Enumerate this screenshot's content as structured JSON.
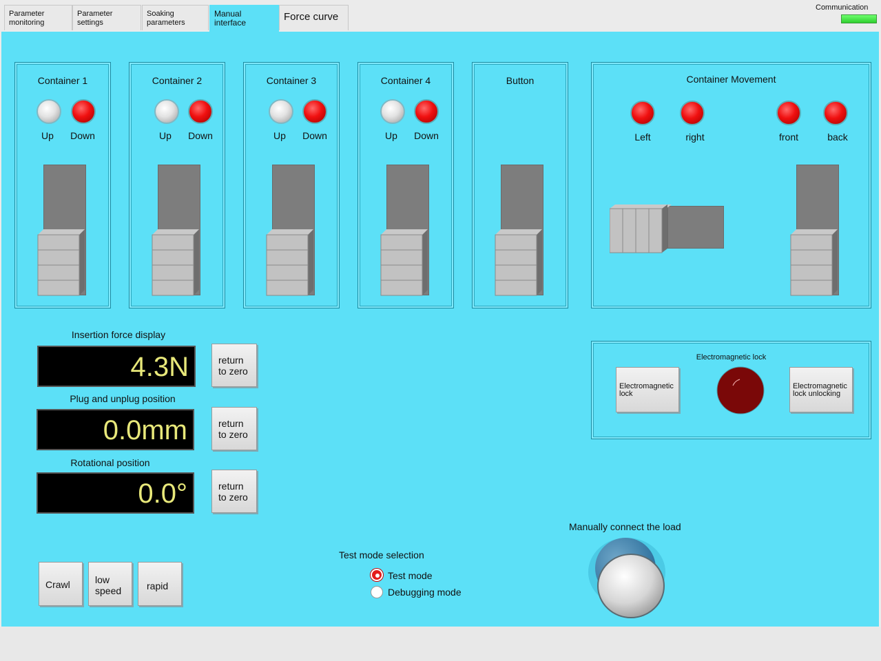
{
  "tabs": [
    {
      "label_1": "Parameter",
      "label_2": "monitoring"
    },
    {
      "label_1": "Parameter",
      "label_2": "settings"
    },
    {
      "label_1": "Soaking",
      "label_2": "parameters"
    },
    {
      "label_1": "Manual",
      "label_2": "interface"
    },
    {
      "label_1": "Force curve",
      "label_2": ""
    }
  ],
  "active_tab": "Manual interface",
  "communication": {
    "label": "Communication",
    "status_color": "#3fdc3f"
  },
  "containers": [
    {
      "title": "Container 1",
      "up": "Up",
      "down": "Down"
    },
    {
      "title": "Container 2",
      "up": "Up",
      "down": "Down"
    },
    {
      "title": "Container 3",
      "up": "Up",
      "down": "Down"
    },
    {
      "title": "Container 4",
      "up": "Up",
      "down": "Down"
    }
  ],
  "button_panel": {
    "title": "Button"
  },
  "movement": {
    "title": "Container Movement",
    "left": "Left",
    "right": "right",
    "front": "front",
    "back": "back"
  },
  "displays": {
    "force": {
      "label": "Insertion force display",
      "value": "4.3N",
      "reset": [
        "return",
        "to zero"
      ]
    },
    "position": {
      "label": "Plug and unplug position",
      "value": "0.0mm",
      "reset": [
        "return",
        "to zero"
      ]
    },
    "rotation": {
      "label": "Rotational position",
      "value": "0.0°",
      "reset": [
        "return",
        "to zero"
      ]
    }
  },
  "speed": {
    "crawl": "Crawl",
    "low": [
      "low",
      "speed"
    ],
    "rapid": "rapid"
  },
  "test_mode": {
    "label": "Test mode selection",
    "options": [
      "Test mode",
      "Debugging mode"
    ],
    "selected": "Test mode"
  },
  "em_lock": {
    "title": "Electromagnetic lock",
    "lock": [
      "Electromagnetic",
      "lock"
    ],
    "unlock": [
      "Electromagnetic",
      "lock unlocking"
    ]
  },
  "load": {
    "label": "Manually connect the load"
  },
  "colors": {
    "background": "#5ce0f7",
    "lamp_on": "#f01010",
    "lamp_off": "#e2e2e2",
    "display_text": "#e8e87a"
  }
}
